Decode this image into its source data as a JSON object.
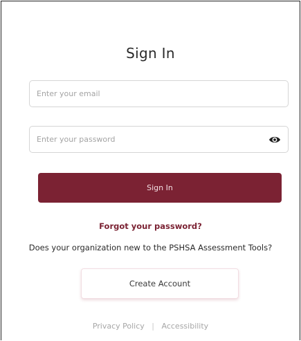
{
  "form": {
    "title": "Sign In",
    "email": {
      "placeholder": "Enter your email",
      "value": ""
    },
    "password": {
      "placeholder": "Enter your password",
      "value": ""
    },
    "password_toggle_icon": "eye-icon",
    "submit_label": "Sign In",
    "forgot_password_label": "Forgot your password?",
    "new_org_prompt": "Does your organization new to the PSHSA Assessment Tools?",
    "create_account_label": "Create Account"
  },
  "footer": {
    "privacy_label": "Privacy Policy",
    "divider": "|",
    "accessibility_label": "Accessibility"
  },
  "colors": {
    "brand": "#7b2233",
    "border": "#d5d5d5",
    "muted_text": "#a6a6a6"
  }
}
